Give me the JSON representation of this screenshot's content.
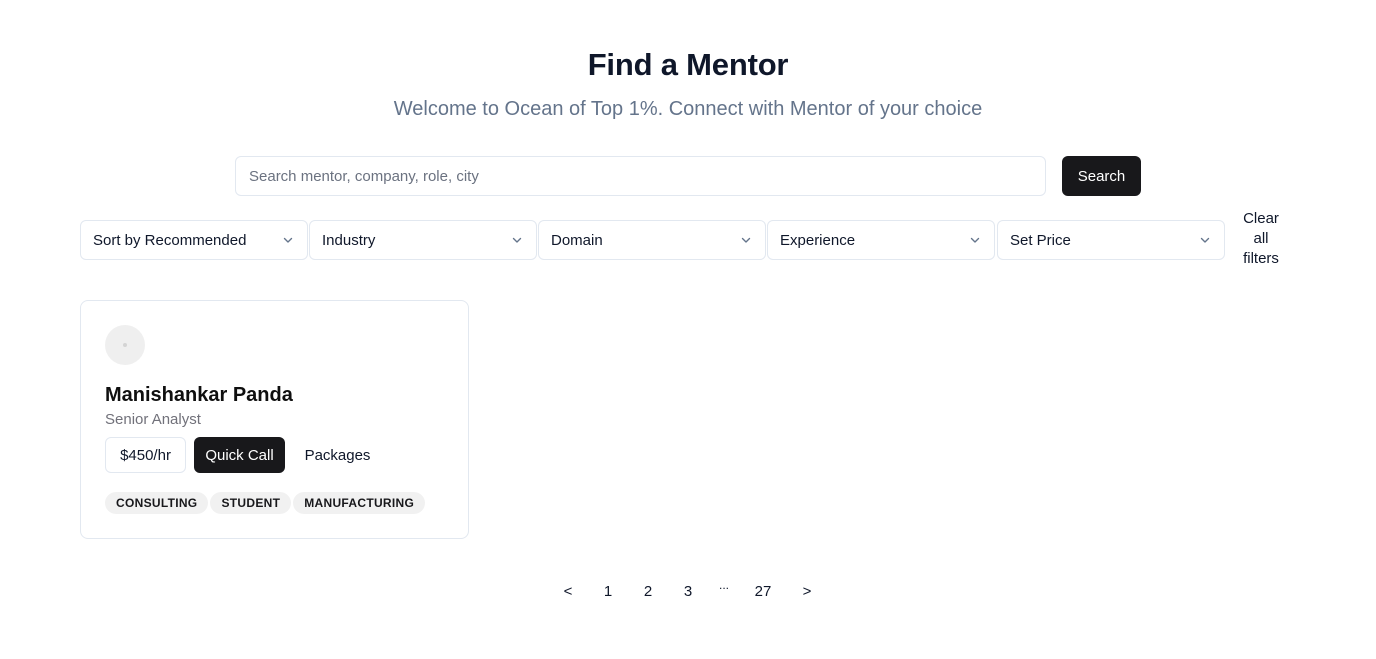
{
  "header": {
    "title": "Find a Mentor",
    "subtitle": "Welcome to Ocean of Top 1%. Connect with Mentor of your choice"
  },
  "search": {
    "placeholder": "Search mentor, company, role, city",
    "value": "",
    "button_label": "Search"
  },
  "filters": {
    "items": [
      {
        "label": "Sort by Recommended"
      },
      {
        "label": "Industry"
      },
      {
        "label": "Domain"
      },
      {
        "label": "Experience"
      },
      {
        "label": "Set Price"
      }
    ],
    "clear_label_lines": [
      "Clear",
      "all",
      "filters"
    ]
  },
  "mentors": [
    {
      "name": "Manishankar Panda",
      "role": "Senior Analyst",
      "price": "$450/hr",
      "quick_call_label": "Quick Call",
      "packages_label": "Packages",
      "tags": [
        "CONSULTING",
        "STUDENT",
        "MANUFACTURING"
      ]
    }
  ],
  "pagination": {
    "prev": "<",
    "pages": [
      "1",
      "2",
      "3"
    ],
    "ellipsis": "...",
    "last": "27",
    "next": ">"
  },
  "colors": {
    "primary_button": "#18181b",
    "border": "#e2e8f0",
    "subtitle": "#64748b",
    "tag_bg": "#f1f1f1"
  },
  "icons": {
    "select_chevron": "chevron-down-icon"
  }
}
